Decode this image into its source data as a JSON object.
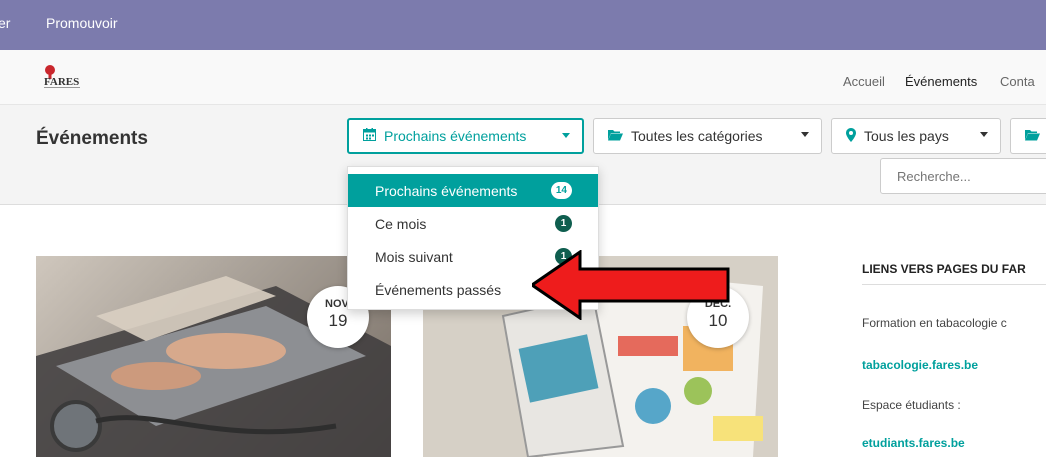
{
  "topbar": {
    "cut_item": "er",
    "item": "Promouvoir"
  },
  "navbar": {
    "logo_text": "FARES",
    "links": [
      "Accueil",
      "Événements",
      "Conta"
    ],
    "active_link": "Événements"
  },
  "page_title": "Événements",
  "filters": [
    {
      "icon": "calendar-icon",
      "label": "Prochains événements"
    },
    {
      "icon": "folder-open-icon",
      "label": "Toutes les catégories"
    },
    {
      "icon": "map-marker-icon",
      "label": "Tous les pays"
    },
    {
      "icon": "folder-open-icon",
      "label": ""
    }
  ],
  "search": {
    "placeholder": "Recherche..."
  },
  "dropdown": {
    "items": [
      {
        "label": "Prochains événements",
        "count": "14",
        "active": true
      },
      {
        "label": "Ce mois",
        "count": "1",
        "active": false
      },
      {
        "label": "Mois suivant",
        "count": "1",
        "active": false
      },
      {
        "label": "Événements passés",
        "count": "",
        "active": false
      }
    ]
  },
  "events": [
    {
      "month": "NOV.",
      "day": "19"
    },
    {
      "month": "DEC.",
      "day": "10"
    }
  ],
  "sidebar": {
    "title": "LIENS VERS PAGES DU FAR",
    "line1": "Formation en tabacologie c",
    "link1": "tabacologie.fares.be",
    "line2": "Espace étudiants :",
    "link2": "etudiants.fares.be"
  },
  "colors": {
    "topbar": "#7c7bad",
    "accent": "#00a09d",
    "badge": "#0f5e4f",
    "arrow_fill": "#ee1c1c",
    "arrow_stroke": "#000000"
  }
}
